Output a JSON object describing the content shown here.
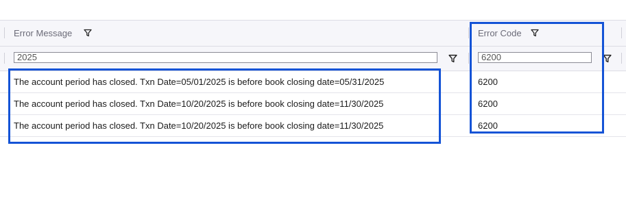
{
  "columns": {
    "error_message": {
      "label": "Error Message",
      "filter_value": "2025"
    },
    "error_code": {
      "label": "Error Code",
      "filter_value": "6200"
    }
  },
  "rows": [
    {
      "error_message": "The account period has closed. Txn Date=05/01/2025 is before book closing date=05/31/2025",
      "error_code": "6200"
    },
    {
      "error_message": "The account period has closed. Txn Date=10/20/2025 is before book closing date=11/30/2025",
      "error_code": "6200"
    },
    {
      "error_message": "The account period has closed. Txn Date=10/20/2025 is before book closing date=11/30/2025",
      "error_code": "6200"
    }
  ],
  "icons": {
    "filter": "funnel-icon"
  },
  "colors": {
    "highlight": "#1453d6",
    "header_bg": "#f6f6fa"
  }
}
